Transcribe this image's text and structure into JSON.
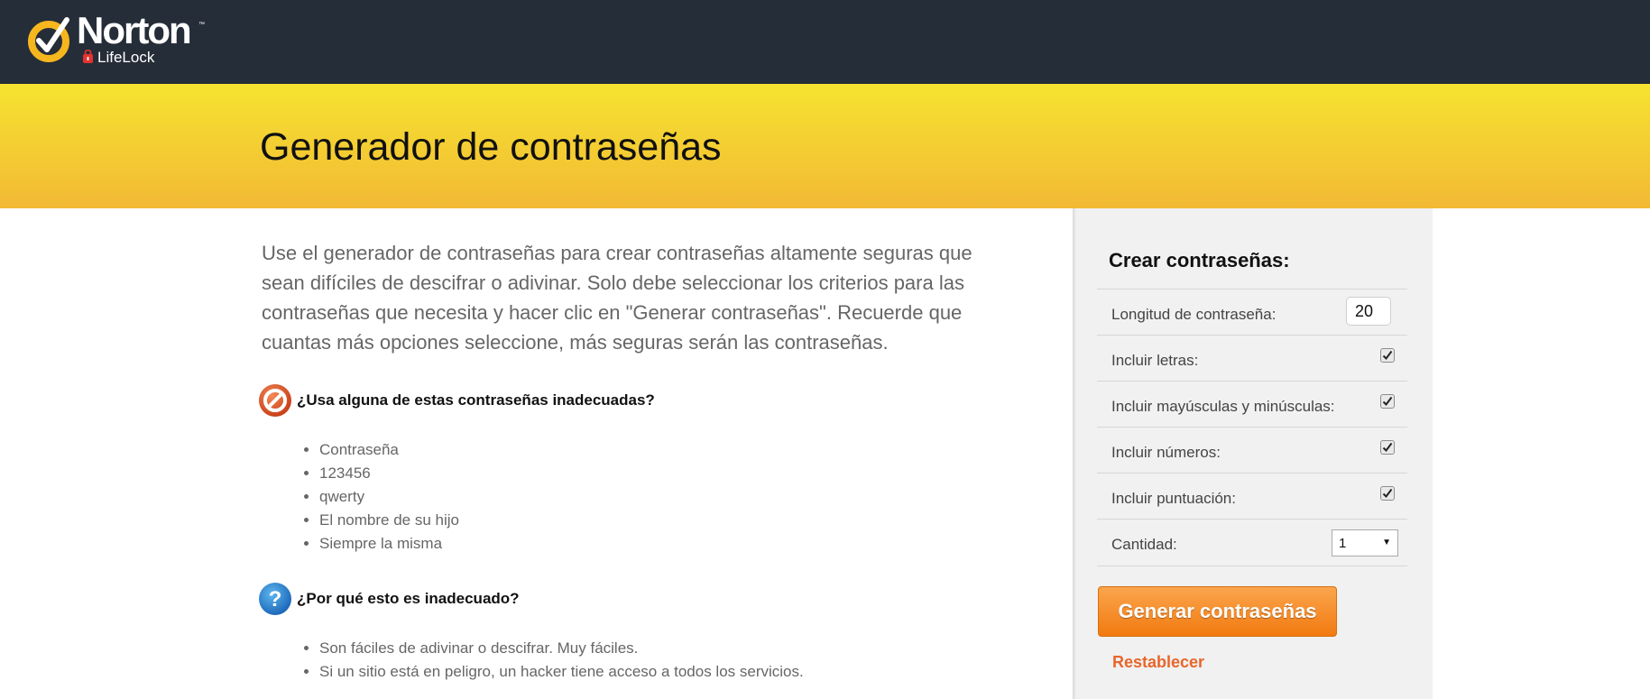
{
  "header": {
    "logo": {
      "brand": "Norton",
      "sub_brand": "LifeLock",
      "trademark": "™"
    },
    "colors": {
      "bar": "#252d38",
      "logo_check": "#f6b61e"
    }
  },
  "banner": {
    "title": "Generador de contraseñas",
    "colors": {
      "top": "#f6e330",
      "bottom": "#f2b934"
    }
  },
  "main": {
    "intro": "Use el generador de contraseñas para crear contraseñas altamente seguras que sean difíciles de descifrar o adivinar. Solo debe seleccionar los criterios para las contraseñas que necesita y hacer clic en \"Generar contraseñas\". Recuerde que cuantas más opciones seleccione, más seguras serán las contraseñas.",
    "bad_section": {
      "heading": "¿Usa alguna de estas contraseñas inadecuadas?",
      "icon": "prohibited-icon",
      "items": [
        "Contraseña",
        "123456",
        "qwerty",
        "El nombre de su hijo",
        "Siempre la misma"
      ]
    },
    "why_section": {
      "heading": "¿Por qué esto es inadecuado?",
      "icon": "question-icon",
      "items": [
        "Son fáciles de adivinar o descifrar. Muy fáciles.",
        "Si un sitio está en peligro, un hacker tiene acceso a todos los servicios."
      ]
    }
  },
  "sidebar": {
    "title": "Crear contraseñas:",
    "length": {
      "label": "Longitud de contraseña:",
      "value": "20"
    },
    "options": [
      {
        "label": "Incluir letras:",
        "checked": true
      },
      {
        "label": "Incluir mayúsculas y minúsculas:",
        "checked": true
      },
      {
        "label": "Incluir números:",
        "checked": true
      },
      {
        "label": "Incluir puntuación:",
        "checked": true
      }
    ],
    "quantity": {
      "label": "Cantidad:",
      "value": "1"
    },
    "generate_label": "Generar contraseñas",
    "reset_label": "Restablecer",
    "colors": {
      "button": "#f17a10",
      "link": "#e8662b",
      "panel": "#f1f1f1"
    }
  }
}
